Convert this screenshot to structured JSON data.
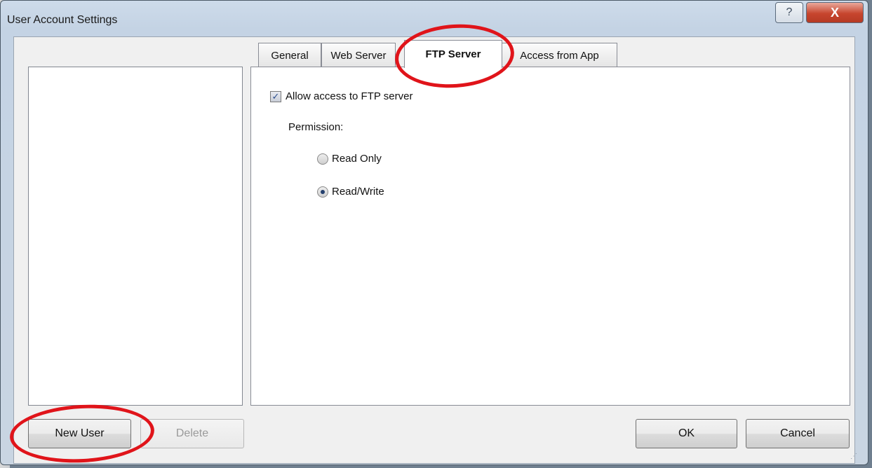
{
  "window": {
    "title": "User Account Settings",
    "help_label": "?",
    "close_label": "X"
  },
  "tabs": [
    {
      "label": "General",
      "active": false
    },
    {
      "label": "Web Server",
      "active": false
    },
    {
      "label": "FTP Server",
      "active": true
    },
    {
      "label": "Access from App",
      "active": false
    }
  ],
  "ftp": {
    "allow_label": "Allow access to FTP server",
    "allow_checked": true,
    "permission_label": "Permission:",
    "options": [
      {
        "label": "Read Only",
        "selected": false
      },
      {
        "label": "Read/Write",
        "selected": true
      }
    ]
  },
  "buttons": {
    "new_user": "New User",
    "delete": "Delete",
    "ok": "OK",
    "cancel": "Cancel"
  },
  "colors": {
    "annotation": "#e0141a",
    "title_bar": "#c4d3e4",
    "close_button": "#c7452e"
  }
}
